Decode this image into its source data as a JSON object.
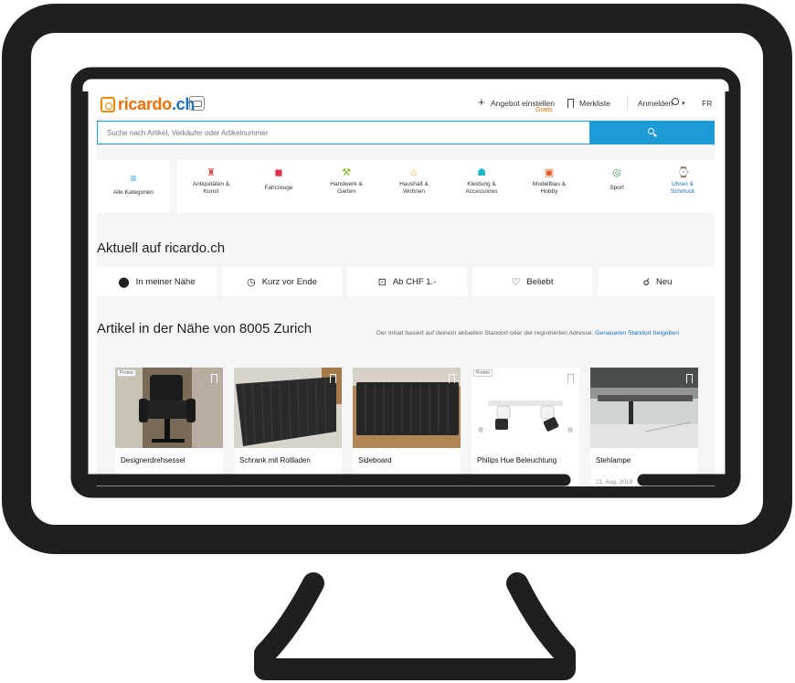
{
  "header": {
    "logo_text": "ricardo",
    "logo_tld": ".ch",
    "sell_label": "Angebot einstellen",
    "sell_badge": "Gratis",
    "watchlist_label": "Merkliste",
    "login_label": "Anmelden",
    "language_label": "FR"
  },
  "search": {
    "placeholder": "Suche nach Artikel, Verkäufer oder Artikelnummer"
  },
  "categories": {
    "all_label": "Alle Kategorien",
    "items": [
      {
        "label": "Antiquitäten &\nKunst",
        "icon": "antiques-icon",
        "color": "#d9534f"
      },
      {
        "label": "Fahrzeuge",
        "icon": "car-icon",
        "color": "#e0344a"
      },
      {
        "label": "Handwerk &\nGarten",
        "icon": "tools-icon",
        "color": "#7cb518"
      },
      {
        "label": "Haushalt &\nWohnen",
        "icon": "household-icon",
        "color": "#f0a500"
      },
      {
        "label": "Kleidung &\nAccessoires",
        "icon": "shirt-icon",
        "color": "#1eb6c8"
      },
      {
        "label": "Modellbau &\nHobby",
        "icon": "train-icon",
        "color": "#e05a2a"
      },
      {
        "label": "Sport",
        "icon": "ball-icon",
        "color": "#3ba34a"
      },
      {
        "label": "Uhren &\nSchmuck",
        "icon": "watch-icon",
        "color": "#1570c4"
      }
    ]
  },
  "current": {
    "title": "Aktuell auf ricardo.ch",
    "filters": [
      {
        "label": "In meiner Nähe",
        "icon": "location-pin-icon"
      },
      {
        "label": "Kurz vor Ende",
        "icon": "alarm-clock-icon"
      },
      {
        "label": "Ab CHF 1.-",
        "icon": "price-tag-icon"
      },
      {
        "label": "Beliebt",
        "icon": "heart-icon"
      },
      {
        "label": "Neu",
        "icon": "new-icon"
      }
    ]
  },
  "nearby": {
    "title": "Artikel in der Nähe von 8005 Zurich",
    "note": "Der Inhalt basiert auf deinem aktuellen Standort oder der registrierten Adresse.",
    "note_link": "Genaueren Standort freigeben",
    "items": [
      {
        "title": "Designerdrehsessel",
        "promo": "Promo",
        "date": ""
      },
      {
        "title": "Schrank mit Rollladen",
        "promo": "",
        "date": ""
      },
      {
        "title": "Sideboard",
        "promo": "",
        "date": ""
      },
      {
        "title": "Philips Hue Beleuchtung",
        "promo": "Promo",
        "date": ""
      },
      {
        "title": "Stehlampe",
        "promo": "",
        "date": "21. Aug. 2019"
      }
    ]
  },
  "colors": {
    "accent": "#1e9bd7",
    "brand_orange": "#f06f00",
    "brand_blue": "#1570c4",
    "frame": "#1f1f1f"
  }
}
